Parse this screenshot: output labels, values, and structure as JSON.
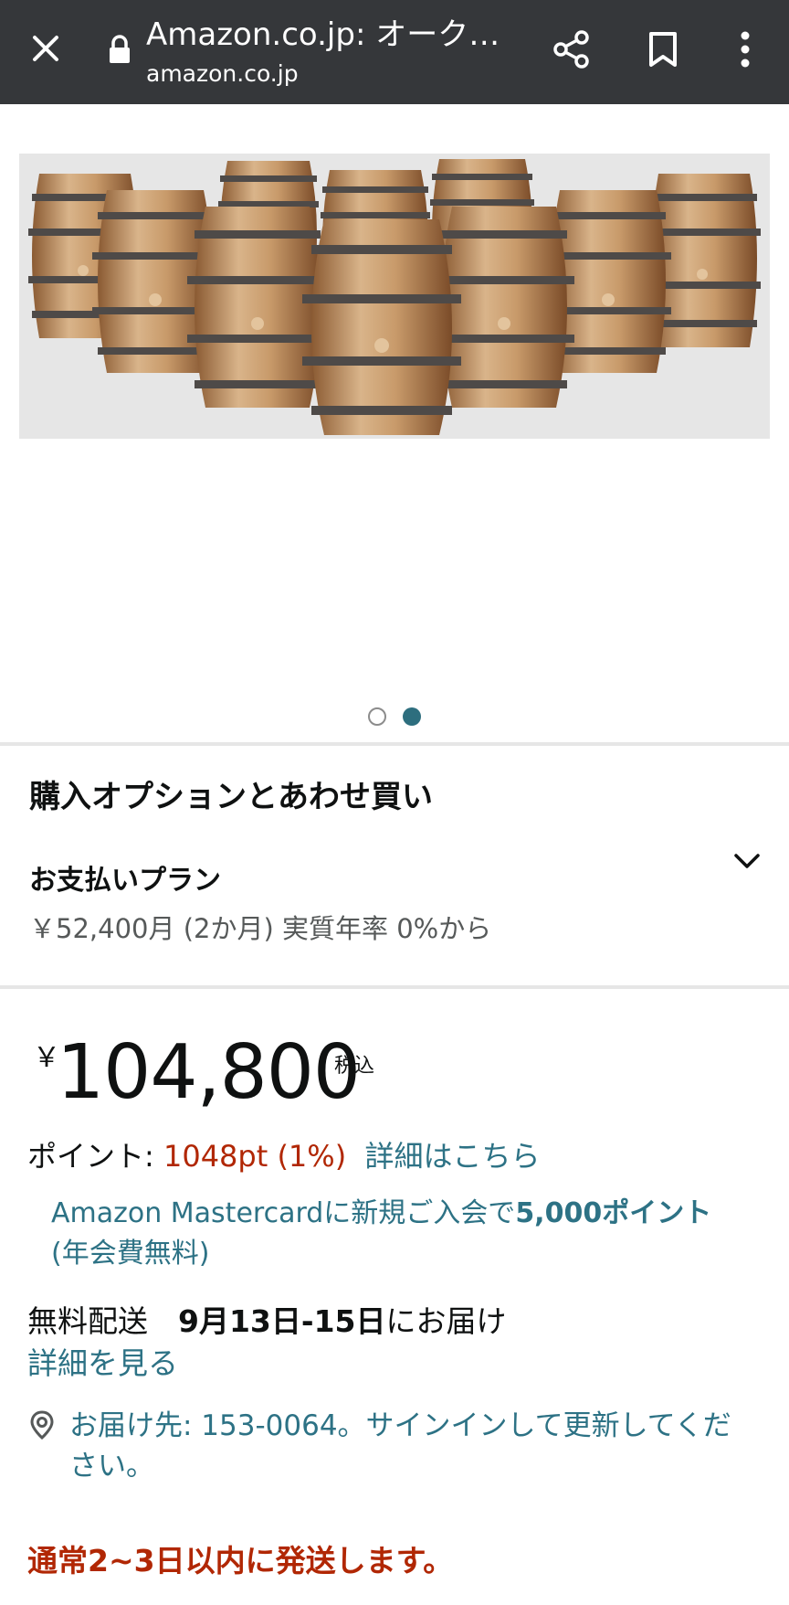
{
  "toolbar": {
    "title": "Amazon.co.jp: オーク…",
    "url": "amazon.co.jp",
    "icons": [
      "close-icon",
      "lock-icon",
      "share-icon",
      "bookmark-icon",
      "more-icon"
    ]
  },
  "gallery": {
    "image_description_name": "oak-barrels-image",
    "page_count": 2,
    "active_page": 2,
    "active_dot_color": "#2d6e7e"
  },
  "options": {
    "section_title": "購入オプションとあわせ買い",
    "plan_label": "お支払いプラン",
    "plan_detail": "￥52,400月 (2か月) 実質年率 0%から"
  },
  "price": {
    "currency": "￥",
    "amount": "104,800",
    "tax_label": "税込"
  },
  "points": {
    "label": "ポイント: ",
    "value": "1048pt  (1%)",
    "link": "詳細はこちら"
  },
  "promo": {
    "text_prefix": "Amazon Mastercardに新規ご入会で",
    "text_bold": "5,000ポイント",
    "text_suffix": "(年会費無料)"
  },
  "delivery": {
    "label": "無料配送　",
    "date": "9月13日-15日",
    "suffix": "にお届け",
    "details_link": "詳細を見る"
  },
  "location": {
    "text": "お届け先: 153-0064。サインインして更新してください。"
  },
  "shipping_note": "通常2~3日以内に発送します。",
  "colors": {
    "toolbar_bg": "#35373a",
    "link": "#2d7285",
    "price_red": "#b12704"
  }
}
